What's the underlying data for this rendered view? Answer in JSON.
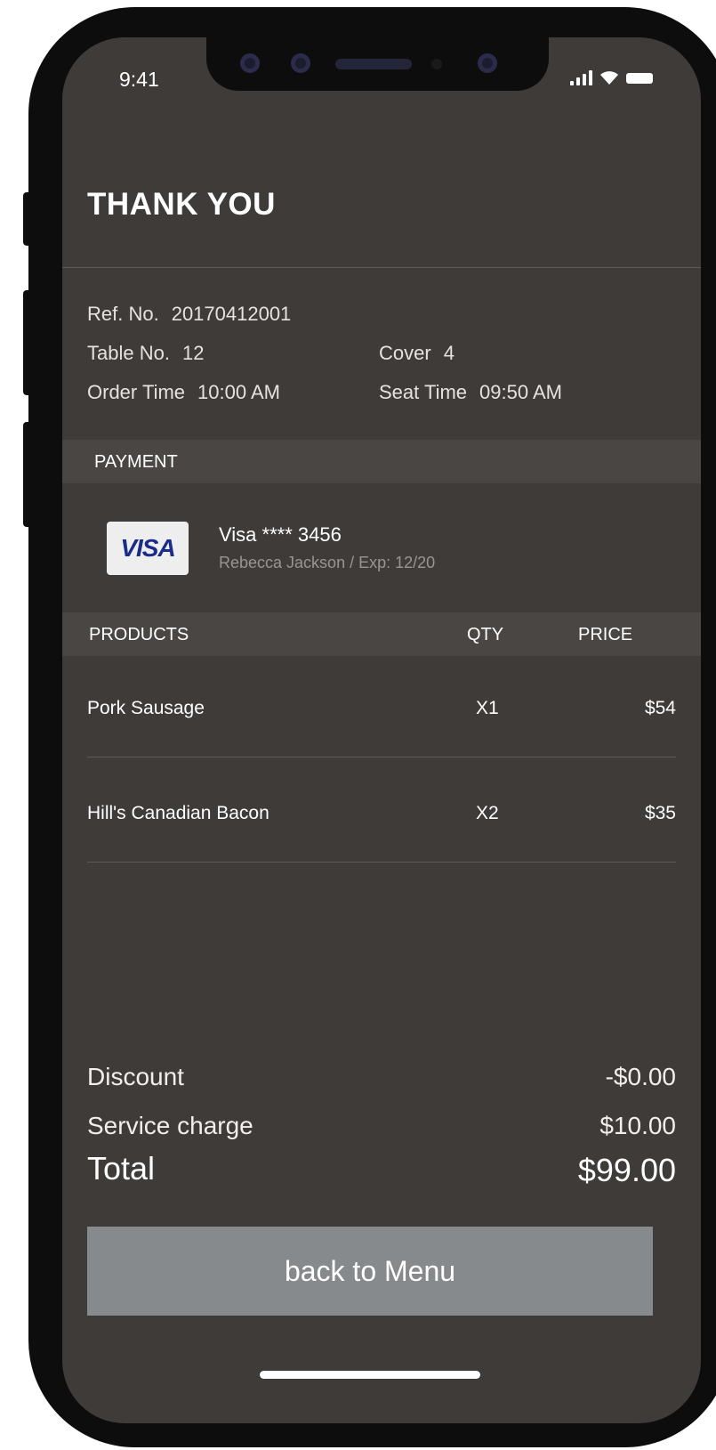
{
  "status_bar": {
    "time": "9:41"
  },
  "header": {
    "title": "THANK YOU"
  },
  "order_info": {
    "ref_label": "Ref. No.",
    "ref_value": "20170412001",
    "table_label": "Table No.",
    "table_value": "12",
    "cover_label": "Cover",
    "cover_value": "4",
    "order_time_label": "Order Time",
    "order_time_value": "10:00 AM",
    "seat_time_label": "Seat Time",
    "seat_time_value": "09:50 AM"
  },
  "payment": {
    "section_label": "PAYMENT",
    "card_brand": "VISA",
    "card_number": "Visa ****  3456",
    "card_holder": "Rebecca Jackson / Exp: 12/20"
  },
  "products": {
    "headers": {
      "product": "PRODUCTS",
      "qty": "QTY",
      "price": "PRICE"
    },
    "items": [
      {
        "name": "Pork Sausage",
        "qty": "X1",
        "price": "$54"
      },
      {
        "name": "Hill's Canadian Bacon",
        "qty": "X2",
        "price": "$35"
      }
    ]
  },
  "summary": {
    "discount_label": "Discount",
    "discount_value": "-$0.00",
    "service_label": "Service charge",
    "service_value": "$10.00",
    "total_label": "Total",
    "total_value": "$99.00"
  },
  "actions": {
    "back_label": "back to Menu"
  },
  "colors": {
    "screen_bg": "#3f3b39",
    "band_bg": "#4a4644",
    "button_bg": "#878a8d",
    "visa_blue": "#1a2c8a"
  }
}
